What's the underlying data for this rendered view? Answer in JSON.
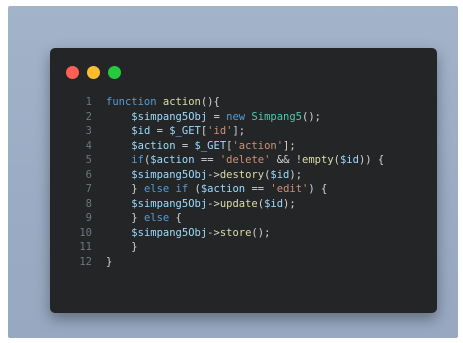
{
  "window_controls": {
    "close_color": "#ff5f56",
    "minimize_color": "#ffbd2e",
    "maximize_color": "#27c93f"
  },
  "code": {
    "lines": [
      {
        "n": "1",
        "tokens": [
          [
            "kw",
            "function "
          ],
          [
            "fn",
            "action"
          ],
          [
            "op",
            "(){"
          ]
        ]
      },
      {
        "n": "2",
        "tokens": [
          [
            "op",
            "    "
          ],
          [
            "var",
            "$simpang5Obj"
          ],
          [
            "op",
            " = "
          ],
          [
            "kw",
            "new "
          ],
          [
            "cls",
            "Simpang5"
          ],
          [
            "op",
            "();"
          ]
        ]
      },
      {
        "n": "3",
        "tokens": [
          [
            "op",
            "    "
          ],
          [
            "var",
            "$id"
          ],
          [
            "op",
            " = "
          ],
          [
            "var",
            "$_GET"
          ],
          [
            "op",
            "["
          ],
          [
            "str",
            "'id'"
          ],
          [
            "op",
            "];"
          ]
        ]
      },
      {
        "n": "4",
        "tokens": [
          [
            "op",
            "    "
          ],
          [
            "var",
            "$action"
          ],
          [
            "op",
            " = "
          ],
          [
            "var",
            "$_GET"
          ],
          [
            "op",
            "["
          ],
          [
            "str",
            "'action'"
          ],
          [
            "op",
            "];"
          ]
        ]
      },
      {
        "n": "5",
        "tokens": [
          [
            "op",
            "    "
          ],
          [
            "kw",
            "if"
          ],
          [
            "op",
            "("
          ],
          [
            "var",
            "$action"
          ],
          [
            "op",
            " == "
          ],
          [
            "str",
            "'delete'"
          ],
          [
            "op",
            " && !"
          ],
          [
            "fn",
            "empty"
          ],
          [
            "op",
            "("
          ],
          [
            "var",
            "$id"
          ],
          [
            "op",
            ")) {"
          ]
        ]
      },
      {
        "n": "6",
        "tokens": [
          [
            "op",
            "    "
          ],
          [
            "var",
            "$simpang5Obj"
          ],
          [
            "op",
            "->"
          ],
          [
            "fn",
            "destory"
          ],
          [
            "op",
            "("
          ],
          [
            "var",
            "$id"
          ],
          [
            "op",
            ");"
          ]
        ]
      },
      {
        "n": "7",
        "tokens": [
          [
            "op",
            "    } "
          ],
          [
            "kw",
            "else if"
          ],
          [
            "op",
            " ("
          ],
          [
            "var",
            "$action"
          ],
          [
            "op",
            " == "
          ],
          [
            "str",
            "'edit'"
          ],
          [
            "op",
            ") {"
          ]
        ]
      },
      {
        "n": "8",
        "tokens": [
          [
            "op",
            "    "
          ],
          [
            "var",
            "$simpang5Obj"
          ],
          [
            "op",
            "->"
          ],
          [
            "fn",
            "update"
          ],
          [
            "op",
            "("
          ],
          [
            "var",
            "$id"
          ],
          [
            "op",
            ");"
          ]
        ]
      },
      {
        "n": "9",
        "tokens": [
          [
            "op",
            "    } "
          ],
          [
            "kw",
            "else"
          ],
          [
            "op",
            " {"
          ]
        ]
      },
      {
        "n": "10",
        "tokens": [
          [
            "op",
            "    "
          ],
          [
            "var",
            "$simpang5Obj"
          ],
          [
            "op",
            "->"
          ],
          [
            "fn",
            "store"
          ],
          [
            "op",
            "();"
          ]
        ]
      },
      {
        "n": "11",
        "tokens": [
          [
            "op",
            "    }"
          ]
        ]
      },
      {
        "n": "12",
        "tokens": [
          [
            "op",
            "}"
          ]
        ]
      }
    ]
  }
}
